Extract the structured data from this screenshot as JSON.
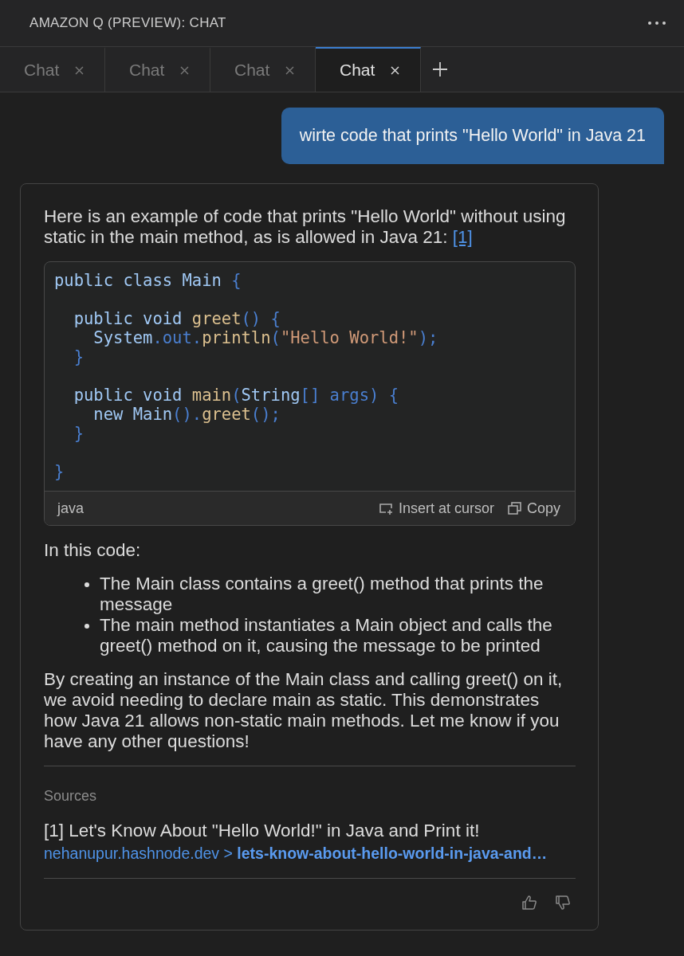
{
  "panel": {
    "title": "AMAZON Q (PREVIEW): CHAT"
  },
  "tabs": [
    {
      "label": "Chat",
      "selected": false
    },
    {
      "label": "Chat",
      "selected": false
    },
    {
      "label": "Chat",
      "selected": false
    },
    {
      "label": "Chat",
      "selected": true
    }
  ],
  "user_message": "wirte code that prints \"Hello World\" in Java 21",
  "answer": {
    "intro": "Here is an example of code that prints \"Hello World\" without using static in the main method, as is allowed in Java 21:",
    "citation": "[1]",
    "code": {
      "language": "java",
      "insert_label": "Insert at cursor",
      "copy_label": "Copy",
      "lines": [
        {
          "kind": "code",
          "tokens": [
            {
              "t": "public class Main ",
              "kind": "plain"
            },
            {
              "t": "{",
              "kind": "punct"
            }
          ]
        },
        {
          "kind": "blank"
        },
        {
          "kind": "code",
          "tokens": [
            {
              "t": "  public void ",
              "kind": "plain"
            },
            {
              "t": "greet",
              "kind": "fn"
            },
            {
              "t": "() {",
              "kind": "punct"
            }
          ]
        },
        {
          "kind": "code",
          "tokens": [
            {
              "t": "    System",
              "kind": "plain"
            },
            {
              "t": ".out.",
              "kind": "punct"
            },
            {
              "t": "println",
              "kind": "fn"
            },
            {
              "t": "(",
              "kind": "punct"
            },
            {
              "t": "\"Hello World!\"",
              "kind": "str"
            },
            {
              "t": ");",
              "kind": "punct"
            }
          ]
        },
        {
          "kind": "code",
          "tokens": [
            {
              "t": "  }",
              "kind": "punct"
            }
          ]
        },
        {
          "kind": "blank"
        },
        {
          "kind": "code",
          "tokens": [
            {
              "t": "  public void ",
              "kind": "plain"
            },
            {
              "t": "main",
              "kind": "fn"
            },
            {
              "t": "(",
              "kind": "punct"
            },
            {
              "t": "String",
              "kind": "plain"
            },
            {
              "t": "[] args) {",
              "kind": "punct"
            }
          ]
        },
        {
          "kind": "code",
          "tokens": [
            {
              "t": "    new Main",
              "kind": "plain"
            },
            {
              "t": "().",
              "kind": "punct"
            },
            {
              "t": "greet",
              "kind": "fn"
            },
            {
              "t": "();",
              "kind": "punct"
            }
          ]
        },
        {
          "kind": "code",
          "tokens": [
            {
              "t": "  }",
              "kind": "punct"
            }
          ]
        },
        {
          "kind": "blank"
        },
        {
          "kind": "code",
          "tokens": [
            {
              "t": "}",
              "kind": "punct"
            }
          ]
        }
      ]
    },
    "lead": "In this code:",
    "bullets": [
      "The Main class contains a greet() method that prints the message",
      "The main method instantiates a Main object and calls the greet() method on it, causing the message to be printed"
    ],
    "closing": "By creating an instance of the Main class and calling greet() on it, we avoid needing to declare main as static. This demonstrates how Java 21 allows non-static main methods. Let me know if you have any other questions!",
    "sources": {
      "heading": "Sources",
      "items": [
        {
          "title": "[1] Let's Know About \"Hello World!\" in Java and Print it!",
          "link": "nehanupur.hashnode.dev > **lets-know-about-hello-world-in-java-and…**"
        }
      ]
    }
  }
}
